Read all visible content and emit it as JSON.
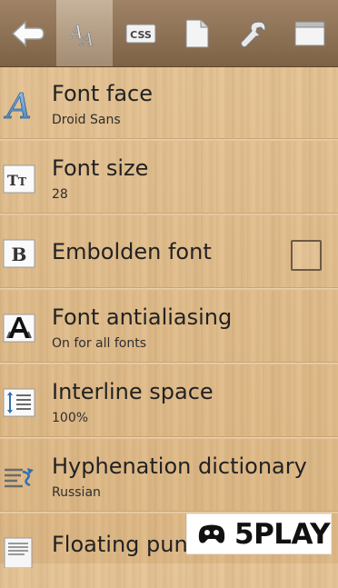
{
  "toolbar": {
    "back_icon": "back-arrow-icon",
    "tabs": [
      {
        "icon": "font-styles-icon",
        "active": true
      },
      {
        "icon": "css-icon",
        "label": "CSS"
      },
      {
        "icon": "page-icon"
      },
      {
        "icon": "wrench-icon"
      },
      {
        "icon": "window-icon"
      }
    ]
  },
  "settings": [
    {
      "title": "Font face",
      "value": "Droid Sans",
      "icon": "font-face-icon"
    },
    {
      "title": "Font size",
      "value": "28",
      "icon": "font-size-icon",
      "icon_text": "TT"
    },
    {
      "title": "Embolden font",
      "icon": "bold-icon",
      "icon_text": "B",
      "checked": false
    },
    {
      "title": "Font antialiasing",
      "value": "On for all fonts",
      "icon": "antialiasing-icon",
      "icon_text": "A"
    },
    {
      "title": "Interline space",
      "value": "100%",
      "icon": "line-spacing-icon"
    },
    {
      "title": "Hyphenation dictionary",
      "value": "Russian",
      "icon": "hyphenation-icon"
    },
    {
      "title": "Floating punctuation",
      "icon": "document-icon"
    }
  ],
  "watermark": {
    "text": "5PLAY",
    "icon": "gamepad-icon"
  }
}
